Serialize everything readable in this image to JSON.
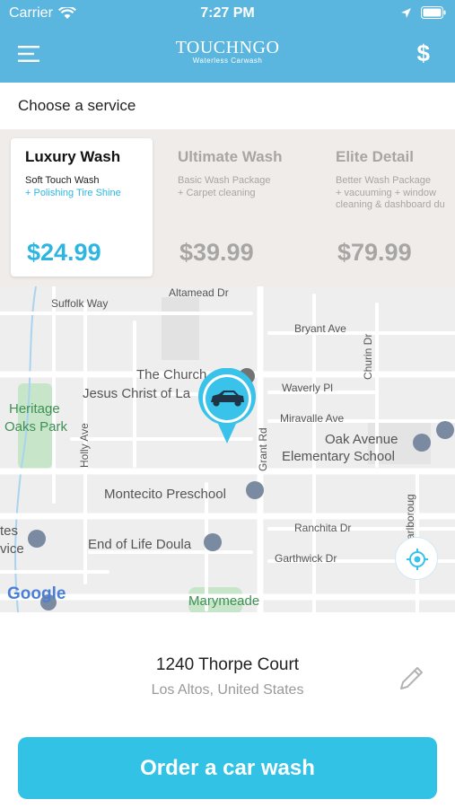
{
  "status_bar": {
    "carrier": "Carrier",
    "time": "7:27 PM"
  },
  "header": {
    "logo": "TOUCHNGO",
    "tagline": "Waterless Carwash",
    "pricing_symbol": "$",
    "background_color": "#5ab6de"
  },
  "section_title": "Choose a service",
  "services": [
    {
      "name": "Luxury Wash",
      "line1": "Soft Touch Wash",
      "line2": "+ Polishing Tire Shine",
      "price": "$24.99",
      "selected": true
    },
    {
      "name": "Ultimate Wash",
      "line1": "Basic Wash Package",
      "line2": "+ Carpet cleaning",
      "price": "$39.99",
      "selected": false
    },
    {
      "name": "Elite Detail",
      "line1": "Better Wash Package",
      "line2": "+ vacuuming + window",
      "line3": "cleaning & dashboard du",
      "price": "$79.99",
      "selected": false
    }
  ],
  "map": {
    "labels": {
      "suffolk": "Suffolk Way",
      "altamead": "Altamead Dr",
      "bryant": "Bryant Ave",
      "churin": "Churin Dr",
      "church1": "The Church",
      "church2": "Jesus Christ of La",
      "waverly": "Waverly Pl",
      "heritage1": "Heritage",
      "heritage2": "Oaks Park",
      "holly": "Holly Ave",
      "grant": "Grant Rd",
      "miravalle": "Miravalle Ave",
      "oak1": "Oak Avenue",
      "oak2": "Elementary School",
      "montecito": "Montecito Preschool",
      "marlborough": "Marlboroug",
      "ranchita": "Ranchita Dr",
      "tes": "tes",
      "vice": "vice",
      "doula": "End of Life Doula",
      "garthwick": "Garthwick Dr",
      "google": "Google",
      "marymeade": "Marymeade"
    }
  },
  "address": {
    "street": "1240 Thorpe Court",
    "city": "Los Altos, United States"
  },
  "order_button": "Order a car wash",
  "accent_color": "#31c2e6"
}
